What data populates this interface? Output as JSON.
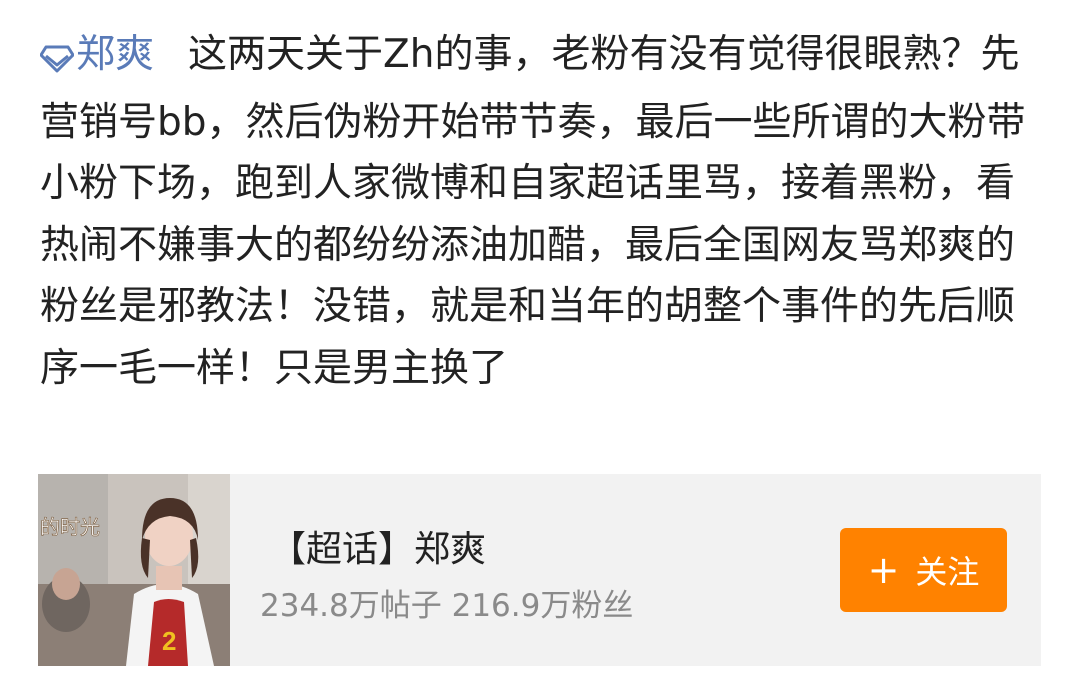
{
  "post": {
    "topic": "郑爽",
    "body": "这两天关于Zh的事，老粉有没有觉得很眼熟？先营销号bb，然后伪粉开始带节奏，最后一些所谓的大粉带小粉下场，跑到人家微博和自家超话里骂，接着黑粉，看热闹不嫌事大的都纷纷添油加醋，最后全国网友骂郑爽的粉丝是邪教法！没错，就是和当年的胡整个事件的先后顺序一毛一样！只是男主换了"
  },
  "card": {
    "title": "【超话】郑爽",
    "stats": "234.8万帖子 216.9万粉丝",
    "follow_icon": "+",
    "follow_label": "关注",
    "thumbnail_caption": "的时光",
    "jersey_number": "2"
  },
  "colors": {
    "link": "#5a7bb8",
    "follow_button": "#ff8200",
    "card_bg": "#f2f2f2"
  }
}
